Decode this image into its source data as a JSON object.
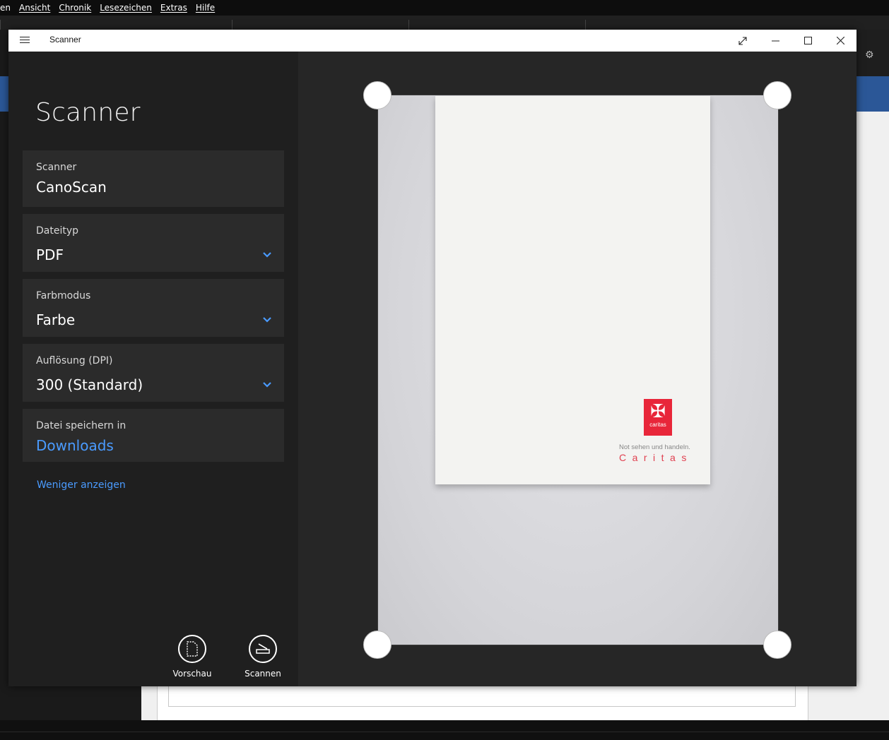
{
  "browser": {
    "menu": [
      "en",
      "Ansicht",
      "Chronik",
      "Lesezeichen",
      "Extras",
      "Hilfe"
    ]
  },
  "window": {
    "title": "Scanner"
  },
  "sidebar": {
    "app_title": "Scanner",
    "scanner": {
      "label": "Scanner",
      "value": "CanoScan"
    },
    "filetype": {
      "label": "Dateityp",
      "value": "PDF"
    },
    "colormode": {
      "label": "Farbmodus",
      "value": "Farbe"
    },
    "resolution": {
      "label": "Auflösung (DPI)",
      "value": "300 (Standard)"
    },
    "save_location": {
      "label": "Datei speichern in",
      "value": "Downloads"
    },
    "show_less": "Weniger anzeigen"
  },
  "actions": {
    "preview": "Vorschau",
    "scan": "Scannen"
  },
  "document": {
    "logo_brand": "caritas",
    "tagline": "Not sehen und handeln.",
    "brand_text": "Caritas"
  },
  "colors": {
    "accent": "#4a9bff",
    "sidebar_bg": "#1f1f1f",
    "card_bg": "#2b2b2b",
    "logo_red": "#e8263a"
  }
}
